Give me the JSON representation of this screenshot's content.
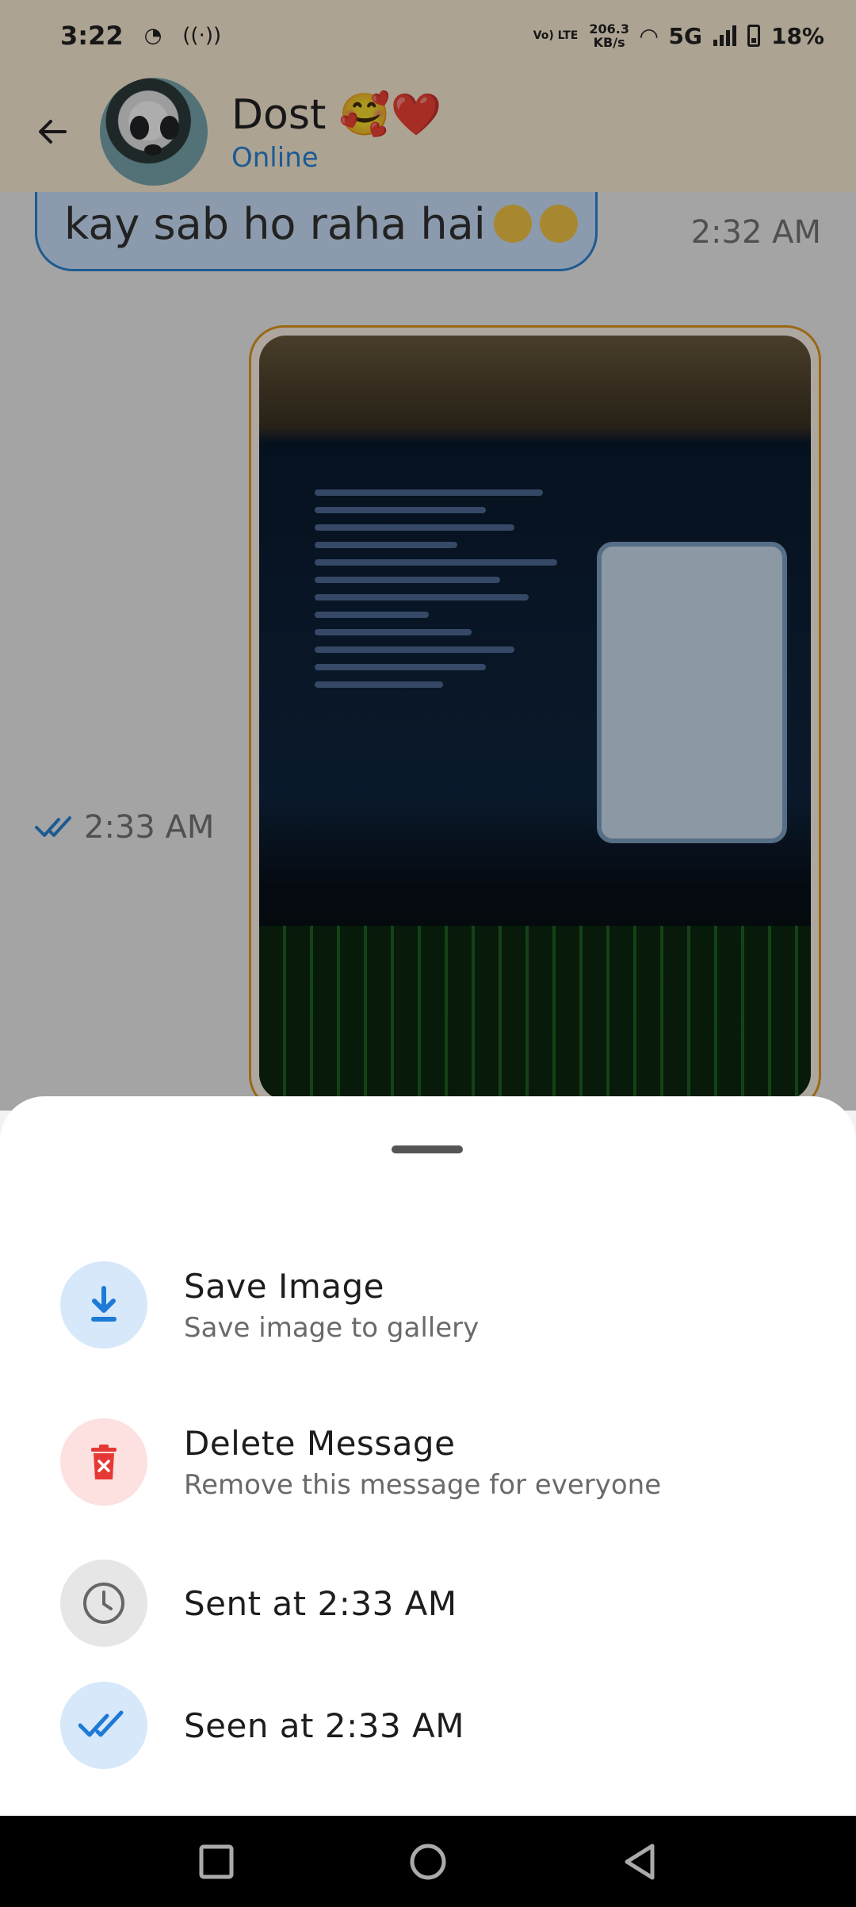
{
  "status_bar": {
    "time": "3:22",
    "volte": "Vo) LTE",
    "speed_value": "206.3",
    "speed_unit": "KB/s",
    "network": "5G",
    "battery": "18%"
  },
  "header": {
    "contact_name": "Dost 🥰❤️",
    "contact_status": "Online"
  },
  "chat": {
    "incoming_text": "kay sab ho raha hai",
    "incoming_time": "2:32 AM",
    "image_sent_time": "2:33 AM"
  },
  "sheet": {
    "options": [
      {
        "title": "Save Image",
        "subtitle": "Save image to gallery",
        "icon": "download-icon"
      },
      {
        "title": "Delete Message",
        "subtitle": "Remove this message for everyone",
        "icon": "delete-icon"
      },
      {
        "title": "Sent at 2:33 AM",
        "icon": "clock-icon"
      },
      {
        "title": "Seen at 2:33 AM",
        "icon": "double-check-icon"
      }
    ]
  },
  "colors": {
    "app_bar": "#fff1d9",
    "accent_blue": "#2a86d6",
    "delete_red": "#e53935",
    "image_border": "#e39a1e"
  }
}
